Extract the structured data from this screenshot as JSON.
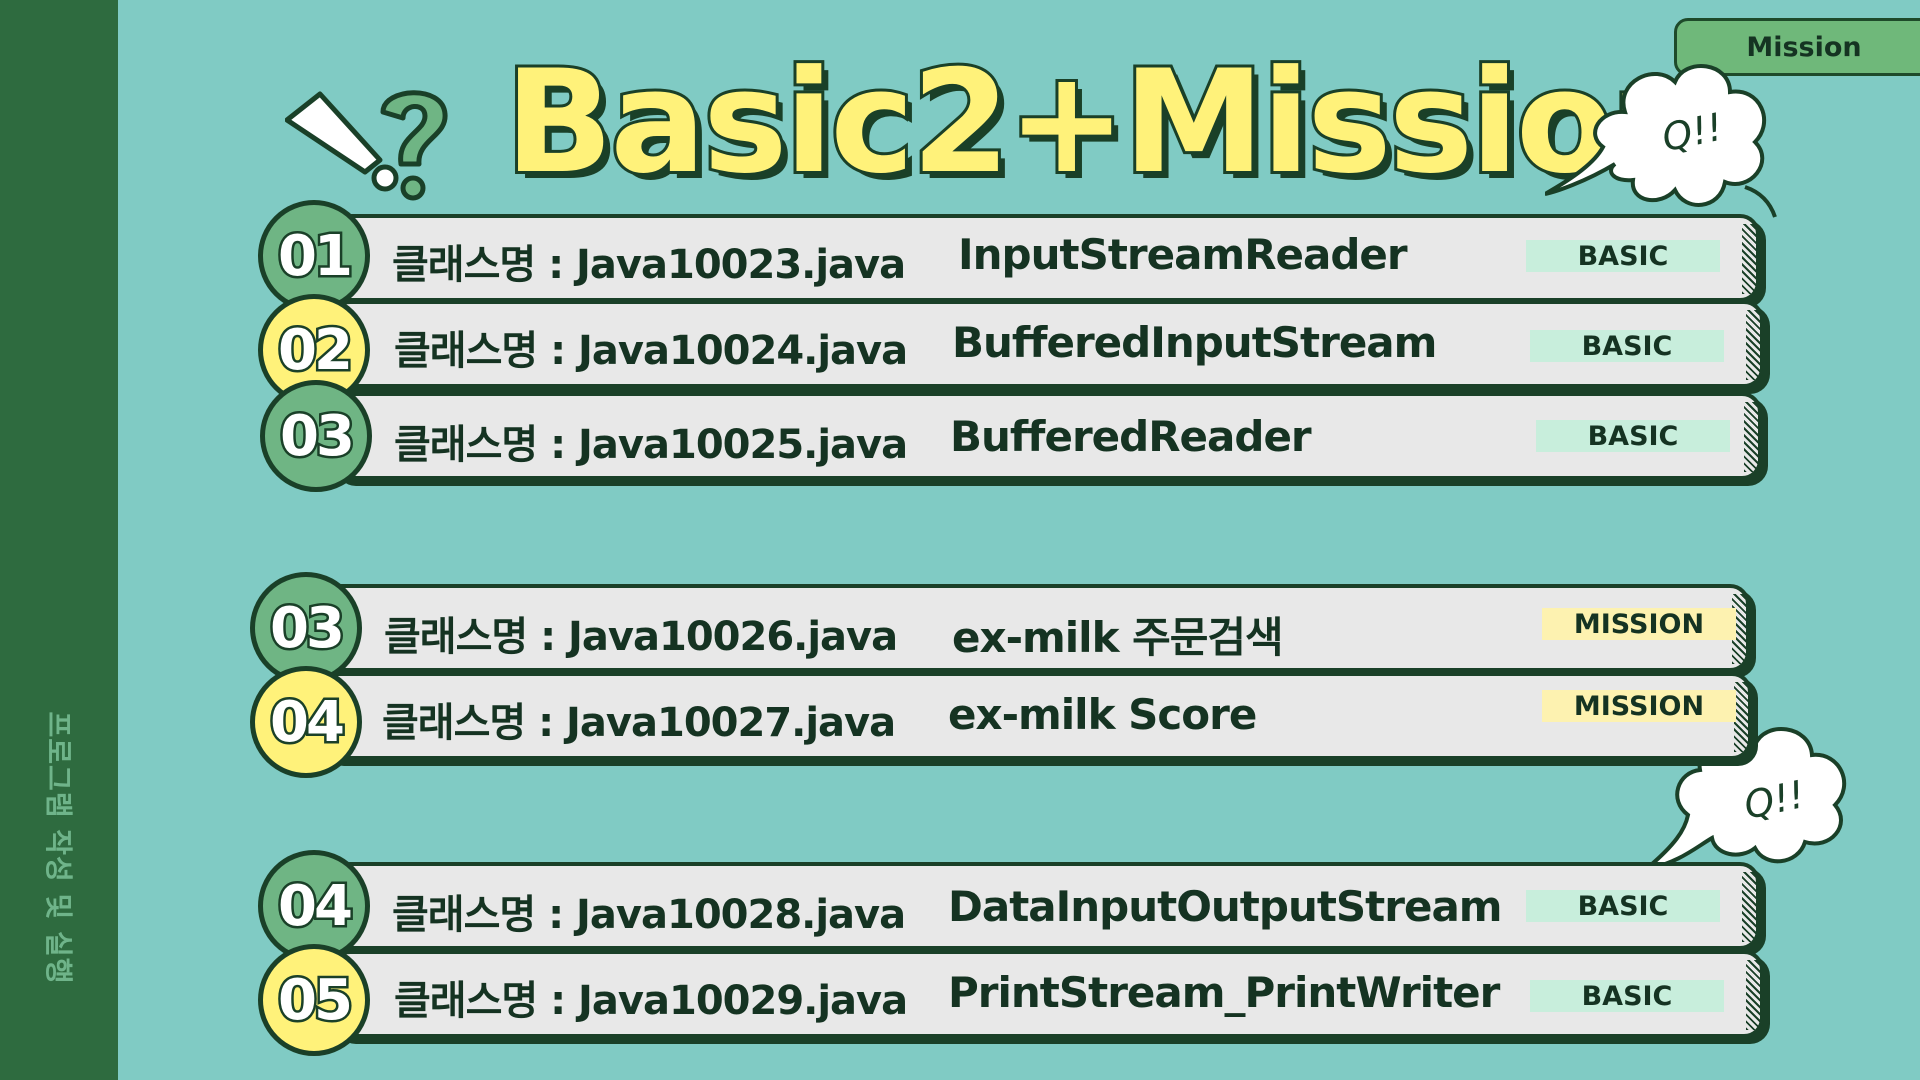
{
  "title": "Basic2+Mission",
  "tab_label": "Mission",
  "side_label": "프로그램 작성 및 실행",
  "bubble_text": "Q!!",
  "colors": {
    "background": "#80cbc4",
    "sidebar": "#2e6b3f",
    "accent_yellow": "#fff27a",
    "accent_green": "#6fb584",
    "outline": "#1a4028"
  },
  "rows": [
    {
      "num": "01",
      "class_label": "클래스명 : Java10023.java",
      "topic": "InputStreamReader",
      "badge": "BASIC"
    },
    {
      "num": "02",
      "class_label": "클래스명 : Java10024.java",
      "topic": "BufferedInputStream",
      "badge": "BASIC"
    },
    {
      "num": "03",
      "class_label": "클래스명 : Java10025.java",
      "topic": "BufferedReader",
      "badge": "BASIC"
    },
    {
      "num": "03",
      "class_label": "클래스명 : Java10026.java",
      "topic": "ex-milk  주문검색",
      "badge": "MISSION"
    },
    {
      "num": "04",
      "class_label": "클래스명 : Java10027.java",
      "topic": "ex-milk  Score",
      "badge": "MISSION"
    },
    {
      "num": "04",
      "class_label": "클래스명 : Java10028.java",
      "topic": "DataInputOutputStream",
      "badge": "BASIC"
    },
    {
      "num": "05",
      "class_label": "클래스명 : Java10029.java",
      "topic": "PrintStream_PrintWriter",
      "badge": "BASIC"
    }
  ]
}
